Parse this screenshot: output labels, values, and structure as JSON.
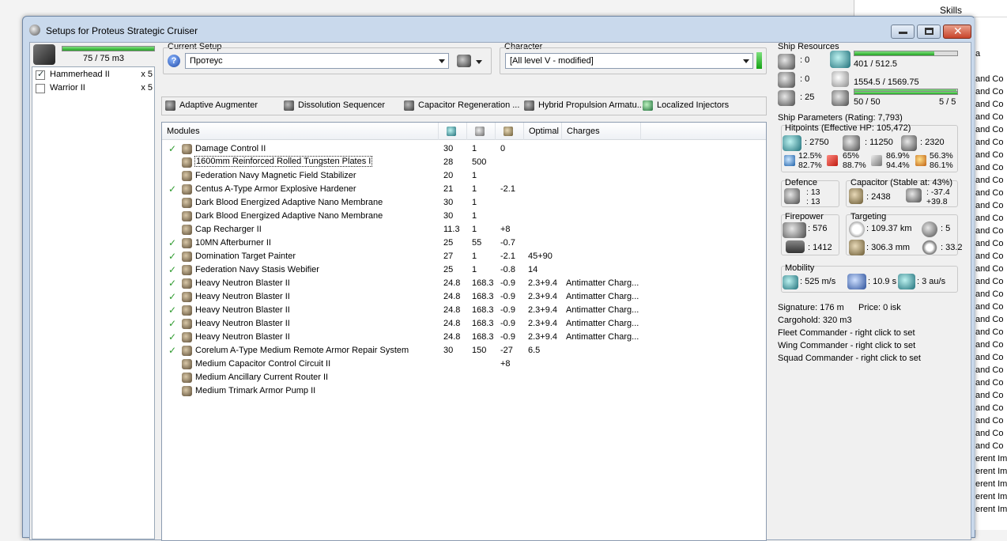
{
  "background_window": {
    "skills_label": "Skills",
    "letter": "a",
    "rows": [
      "and Co",
      "and Co",
      "and Co",
      "and Co",
      "and Co",
      "and Co",
      "and Co",
      "and Co",
      "and Co",
      "and Co",
      "and Co",
      "and Co",
      "and Co",
      "and Co",
      "and Co",
      "and Co",
      "and Co",
      "and Co",
      "and Co",
      "and Co",
      "and Co",
      "and Co",
      "and Co",
      "and Co",
      "and Co",
      "and Co",
      "and Co",
      "and Co",
      "and Co",
      "and Co",
      "erent Imp",
      "erent Imp",
      "erent Imp",
      "erent Imp",
      "erent Imp"
    ]
  },
  "window": {
    "title": "Setups for Proteus Strategic Cruiser"
  },
  "drones": {
    "bay": "75 / 75 m3",
    "bay_fill": 1.0,
    "items": [
      {
        "name": "Hammerhead II",
        "qty": "x 5",
        "checked": true
      },
      {
        "name": "Warrior II",
        "qty": "x 5",
        "checked": false
      }
    ]
  },
  "setup": {
    "current_label": "Current Setup",
    "current_value": "Протеус",
    "character_label": "Character",
    "character_value": "[All level V - modified]"
  },
  "subsystems": [
    "Adaptive Augmenter",
    "Dissolution Sequencer",
    "Capacitor Regeneration ...",
    "Hybrid Propulsion Armatu...",
    "Localized Injectors"
  ],
  "modules": {
    "headers": {
      "name": "Modules",
      "optimal": "Optimal",
      "charges": "Charges"
    },
    "header_icons": [
      "cpu-icon",
      "powergrid-icon",
      "capacitor-icon"
    ],
    "rows": [
      {
        "checked": true,
        "name": "Damage Control II",
        "cpu": "30",
        "pg": "1",
        "cap": "0",
        "optimal": "",
        "charges": ""
      },
      {
        "checked": false,
        "name": "1600mm Reinforced Rolled Tungsten Plates I",
        "cpu": "28",
        "pg": "500",
        "cap": "",
        "optimal": "",
        "charges": "",
        "selected": true
      },
      {
        "checked": false,
        "name": "Federation Navy Magnetic Field Stabilizer",
        "cpu": "20",
        "pg": "1",
        "cap": "",
        "optimal": "",
        "charges": ""
      },
      {
        "checked": true,
        "name": "Centus A-Type Armor Explosive Hardener",
        "cpu": "21",
        "pg": "1",
        "cap": "-2.1",
        "optimal": "",
        "charges": ""
      },
      {
        "checked": false,
        "name": "Dark Blood Energized Adaptive Nano Membrane",
        "cpu": "30",
        "pg": "1",
        "cap": "",
        "optimal": "",
        "charges": ""
      },
      {
        "checked": false,
        "name": "Dark Blood Energized Adaptive Nano Membrane",
        "cpu": "30",
        "pg": "1",
        "cap": "",
        "optimal": "",
        "charges": ""
      },
      {
        "checked": false,
        "name": "Cap Recharger II",
        "cpu": "11.3",
        "pg": "1",
        "cap": "+8",
        "optimal": "",
        "charges": ""
      },
      {
        "checked": true,
        "name": "10MN Afterburner II",
        "cpu": "25",
        "pg": "55",
        "cap": "-0.7",
        "optimal": "",
        "charges": ""
      },
      {
        "checked": true,
        "name": "Domination Target Painter",
        "cpu": "27",
        "pg": "1",
        "cap": "-2.1",
        "optimal": "45+90",
        "charges": ""
      },
      {
        "checked": true,
        "name": "Federation Navy Stasis Webifier",
        "cpu": "25",
        "pg": "1",
        "cap": "-0.8",
        "optimal": "14",
        "charges": ""
      },
      {
        "checked": true,
        "name": "Heavy Neutron Blaster II",
        "cpu": "24.8",
        "pg": "168.3",
        "cap": "-0.9",
        "optimal": "2.3+9.4",
        "charges": "Antimatter Charg..."
      },
      {
        "checked": true,
        "name": "Heavy Neutron Blaster II",
        "cpu": "24.8",
        "pg": "168.3",
        "cap": "-0.9",
        "optimal": "2.3+9.4",
        "charges": "Antimatter Charg..."
      },
      {
        "checked": true,
        "name": "Heavy Neutron Blaster II",
        "cpu": "24.8",
        "pg": "168.3",
        "cap": "-0.9",
        "optimal": "2.3+9.4",
        "charges": "Antimatter Charg..."
      },
      {
        "checked": true,
        "name": "Heavy Neutron Blaster II",
        "cpu": "24.8",
        "pg": "168.3",
        "cap": "-0.9",
        "optimal": "2.3+9.4",
        "charges": "Antimatter Charg..."
      },
      {
        "checked": true,
        "name": "Heavy Neutron Blaster II",
        "cpu": "24.8",
        "pg": "168.3",
        "cap": "-0.9",
        "optimal": "2.3+9.4",
        "charges": "Antimatter Charg..."
      },
      {
        "checked": true,
        "name": "Corelum A-Type Medium Remote Armor Repair System",
        "cpu": "30",
        "pg": "150",
        "cap": "-27",
        "optimal": "6.5",
        "charges": ""
      },
      {
        "checked": false,
        "name": "Medium Capacitor Control Circuit II",
        "cpu": "",
        "pg": "",
        "cap": "+8",
        "optimal": "",
        "charges": ""
      },
      {
        "checked": false,
        "name": "Medium Ancillary Current Router II",
        "cpu": "",
        "pg": "",
        "cap": "",
        "optimal": "",
        "charges": ""
      },
      {
        "checked": false,
        "name": "Medium Trimark Armor Pump II",
        "cpu": "",
        "pg": "",
        "cap": "",
        "optimal": "",
        "charges": ""
      }
    ]
  },
  "resources": {
    "title": "Ship Resources",
    "turrets": ": 0",
    "launchers": ": 0",
    "calibration": ": 25",
    "cpu": "401 / 512.5",
    "cpu_fill": 0.78,
    "powergrid": "1554.5 / 1569.75",
    "powergrid_fill": 0.99,
    "drone_bandwidth": "50 / 50",
    "drone_bandwidth_fill": 1.0,
    "drones_active": "5 / 5"
  },
  "params": {
    "title": "Ship Parameters (Rating: 7,793)",
    "hitpoints_title": "Hitpoints (Effective HP: 105,472)",
    "shield_hp": ": 2750",
    "armor_hp": ": 11250",
    "structure_hp": ": 2320",
    "res_em": [
      "12.5%",
      "82.7%"
    ],
    "res_thermal": [
      "65%",
      "88.7%"
    ],
    "res_kinetic": [
      "86.9%",
      "94.4%"
    ],
    "res_explosive": [
      "56.3%",
      "86.1%"
    ],
    "defence_title": "Defence",
    "defence_values": [
      ": 13",
      ": 13"
    ],
    "capacitor_title": "Capacitor (Stable at: 43%)",
    "capacitor_amount": ": 2438",
    "capacitor_delta": [
      ": -37.4",
      "+39.8"
    ],
    "firepower_title": "Firepower",
    "firepower_turret": ": 576",
    "firepower_drone": ": 1412",
    "targeting_title": "Targeting",
    "targeting_range": ": 109.37 km",
    "max_targets": ": 5",
    "scan_res": ": 306.3 mm",
    "sensor_strength": ": 33.2",
    "mobility_title": "Mobility",
    "speed": ": 525 m/s",
    "align_time": ": 10.9 s",
    "warp_speed": ": 3 au/s",
    "signature": "Signature: 176 m",
    "price": "Price: 0 isk",
    "cargohold": "Cargohold: 320 m3",
    "fleet_commander": "Fleet Commander - right click to set",
    "wing_commander": "Wing Commander - right click to set",
    "squad_commander": "Squad Commander - right click to set"
  },
  "colors": {
    "bar_green": "#23a323",
    "check_green": "#2e9b2e",
    "window_frame": "#c9d9ec"
  }
}
